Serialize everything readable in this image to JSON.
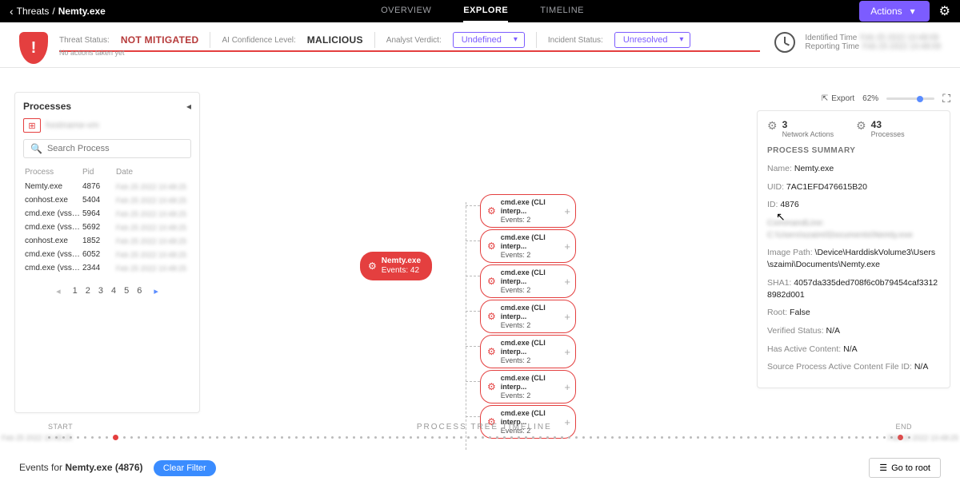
{
  "breadcrumb": {
    "root": "Threats",
    "current": "Nemty.exe"
  },
  "tabs": {
    "t1": "OVERVIEW",
    "t2": "EXPLORE",
    "t3": "TIMELINE"
  },
  "actions_btn": "Actions",
  "status": {
    "threat_label": "Threat Status:",
    "threat_value": "NOT MITIGATED",
    "ai_label": "AI Confidence Level:",
    "ai_value": "MALICIOUS",
    "analyst_label": "Analyst Verdict:",
    "analyst_value": "Undefined",
    "incident_label": "Incident Status:",
    "incident_value": "Unresolved",
    "identified": "Identified Time",
    "reporting": "Reporting Time",
    "no_actions": "No actions taken yet"
  },
  "sidebar": {
    "title": "Processes",
    "search_placeholder": "Search Process",
    "cols": {
      "process": "Process",
      "pid": "Pid",
      "date": "Date"
    },
    "rows": [
      {
        "name": "Nemty.exe",
        "pid": "4876"
      },
      {
        "name": "conhost.exe",
        "pid": "5404"
      },
      {
        "name": "cmd.exe (vssadmi...",
        "pid": "5964"
      },
      {
        "name": "cmd.exe (vssadmi...",
        "pid": "5692"
      },
      {
        "name": "conhost.exe",
        "pid": "1852"
      },
      {
        "name": "cmd.exe (vssadmi...",
        "pid": "6052"
      },
      {
        "name": "cmd.exe (vssadmi...",
        "pid": "2344"
      }
    ],
    "pages": [
      "1",
      "2",
      "3",
      "4",
      "5",
      "6"
    ]
  },
  "tree": {
    "root": {
      "name": "Nemty.exe",
      "sub": "Events: 42"
    },
    "children": [
      {
        "name": "cmd.exe (CLI interp...",
        "sub": "Events: 2"
      },
      {
        "name": "cmd.exe (CLI interp...",
        "sub": "Events: 2"
      },
      {
        "name": "cmd.exe (CLI interp...",
        "sub": "Events: 2"
      },
      {
        "name": "cmd.exe (CLI interp...",
        "sub": "Events: 2"
      },
      {
        "name": "cmd.exe (CLI interp...",
        "sub": "Events: 2"
      },
      {
        "name": "cmd.exe (CLI interp...",
        "sub": "Events: 2"
      },
      {
        "name": "cmd.exe (CLI interp...",
        "sub": "Events: 2"
      }
    ]
  },
  "toolbar": {
    "export": "Export",
    "zoom": "62%"
  },
  "stats": {
    "na_num": "3",
    "na_lbl": "Network Actions",
    "pr_num": "43",
    "pr_lbl": "Processes"
  },
  "summary": {
    "title": "PROCESS SUMMARY",
    "name_k": "Name:",
    "name_v": "Nemty.exe",
    "uid_k": "UID:",
    "uid_v": "7AC1EFD476615B20",
    "id_k": "ID:",
    "id_v": "4876",
    "path_k": "Image Path:",
    "path_v": "\\Device\\HarddiskVolume3\\Users\\szaimi\\Documents\\Nemty.exe",
    "sha_k": "SHA1:",
    "sha_v": "4057da335ded708f6c0b79454caf33128982d001",
    "root_k": "Root:",
    "root_v": "False",
    "verified_k": "Verified Status:",
    "verified_v": "N/A",
    "active_k": "Has Active Content:",
    "active_v": "N/A",
    "source_k": "Source Process Active Content File ID:",
    "source_v": "N/A"
  },
  "timeline": {
    "start": "START",
    "mid": "PROCESS TREE TIMELINE",
    "end": "END"
  },
  "bottom": {
    "events_for": "Events for ",
    "proc": "Nemty.exe (4876)",
    "clear": "Clear Filter",
    "goto": "Go to root"
  }
}
